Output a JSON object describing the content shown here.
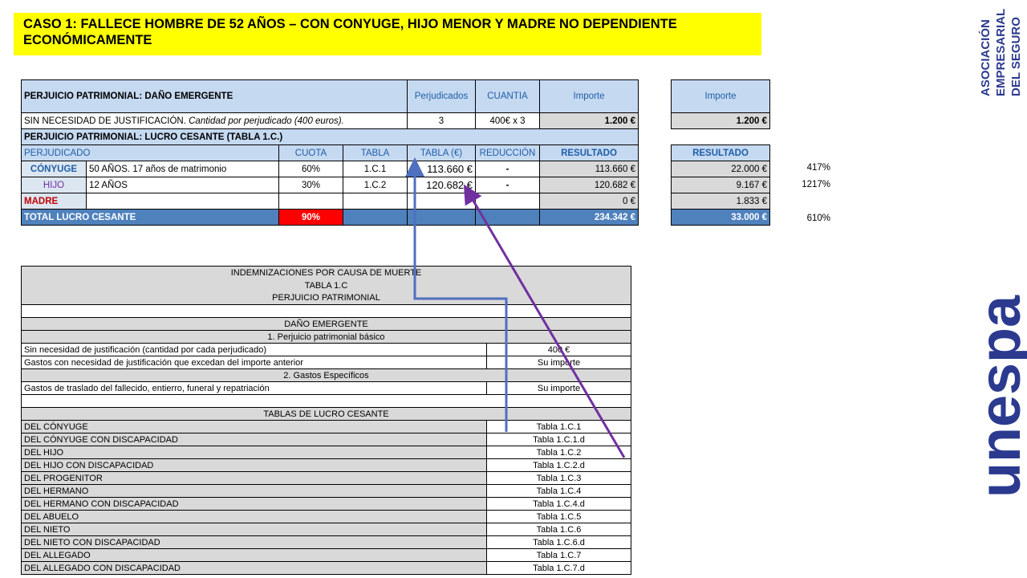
{
  "title": "CASO 1:  FALLECE HOMBRE DE 52 AÑOS  –  CON CONYUGE, HIJO MENOR Y MADRE NO DEPENDIENTE ECONÓMICAMENTE",
  "dano": {
    "header": "PERJUICIO PATRIMONIAL: DAÑO EMERGENTE",
    "col_perjudicados": "Perjudicados",
    "col_cuantia": "CUANTIA",
    "col_importe": "Importe",
    "col_importe2": "Importe",
    "row_label": "SIN NECESIDAD DE JUSTIFICACIÓN.",
    "row_label_italic": "Cantidad por perjudicado (400 euros).",
    "row_perjudicados": "3",
    "row_cuantia": "400€ x 3",
    "row_importe": "1.200 €",
    "row_importe2": "1.200 €"
  },
  "lucro": {
    "header": "PERJUICIO PATRIMONIAL: LUCRO CESANTE (TABLA 1.C.)",
    "col_perjudicado": "PERJUDICADO",
    "col_cuota": "CUOTA",
    "col_tabla": "TABLA",
    "col_tabla_eur": "TABLA (€)",
    "col_reduccion": "REDUCCIÓN",
    "col_resultado": "RESULTADO",
    "col_resultado2": "RESULTADO",
    "rows": [
      {
        "label": "CÓNYUGE",
        "desc": "50 AÑOS. 17 años de matrimonio",
        "cuota": "60%",
        "tabla": "1.C.1",
        "tabla_eur": "113.660 €",
        "reduccion": "-",
        "resultado": "113.660 €",
        "resultado2": "22.000 €",
        "pct": "417%"
      },
      {
        "label": "HIJO",
        "desc": "12 AÑOS",
        "cuota": "30%",
        "tabla": "1.C.2",
        "tabla_eur": "120.682 €",
        "reduccion": "-",
        "resultado": "120.682 €",
        "resultado2": "9.167 €",
        "pct": "1217%"
      },
      {
        "label": "MADRE",
        "desc": "",
        "cuota": "",
        "tabla": "",
        "tabla_eur": "",
        "reduccion": "",
        "resultado": "0 €",
        "resultado2": "1.833 €",
        "pct": ""
      }
    ],
    "total_label": "TOTAL LUCRO CESANTE",
    "total_cuota": "90%",
    "total_resultado": "234.342 €",
    "total_resultado2": "33.000 €",
    "total_pct": "610%"
  },
  "ref": {
    "title1": "INDEMNIZACIONES POR CAUSA DE MUERTE",
    "title2": "TABLA 1.C",
    "title3": "PERJUICIO PATRIMONIAL",
    "dano_header": "DAÑO EMERGENTE",
    "basico_header": "1. Perjuicio patrimonial básico",
    "basico_rows": [
      {
        "label": "Sin necesidad de justificación (cantidad por cada perjudicado)",
        "value": "400 €"
      },
      {
        "label": "Gastos con necesidad de justificación que excedan del importe anterior",
        "value": "Su importe"
      }
    ],
    "especificos_header": "2. Gastos Específicos",
    "especificos_rows": [
      {
        "label": "Gastos de traslado del fallecido, entierro, funeral y repatriación",
        "value": "Su importe"
      }
    ],
    "lucro_header": "TABLAS DE LUCRO CESANTE",
    "lucro_rows": [
      {
        "label": "DEL CÓNYUGE",
        "value": "Tabla 1.C.1"
      },
      {
        "label": "DEL CÓNYUGE CON DISCAPACIDAD",
        "value": "Tabla 1.C.1.d"
      },
      {
        "label": "DEL HIJO",
        "value": "Tabla 1.C.2"
      },
      {
        "label": "DEL HIJO CON DISCAPACIDAD",
        "value": "Tabla 1.C.2.d"
      },
      {
        "label": "DEL PROGENITOR",
        "value": "Tabla 1.C.3"
      },
      {
        "label": "DEL HERMANO",
        "value": "Tabla 1.C.4"
      },
      {
        "label": "DEL HERMANO CON DISCAPACIDAD",
        "value": "Tabla 1.C.4.d"
      },
      {
        "label": "DEL ABUELO",
        "value": "Tabla 1.C.5"
      },
      {
        "label": "DEL NIETO",
        "value": "Tabla 1.C.6"
      },
      {
        "label": "DEL NIETO CON DISCAPACIDAD",
        "value": "Tabla 1.C.6.d"
      },
      {
        "label": "DEL ALLEGADO",
        "value": "Tabla 1.C.7"
      },
      {
        "label": "DEL ALLEGADO CON DISCAPACIDAD",
        "value": "Tabla 1.C.7.d"
      }
    ]
  },
  "logo": {
    "brand": "unespa",
    "line1": "ASOCIACIÓN",
    "line2": "EMPRESARIAL",
    "line3": "DEL SEGURO"
  },
  "colors": {
    "title_bg": "#ffff00",
    "header_bg": "#c5d9f1",
    "total_bg": "#4f81bd",
    "arrow_blue": "#4f6fbf",
    "arrow_purple": "#7030a0",
    "logo_color": "#2b3a8f"
  }
}
